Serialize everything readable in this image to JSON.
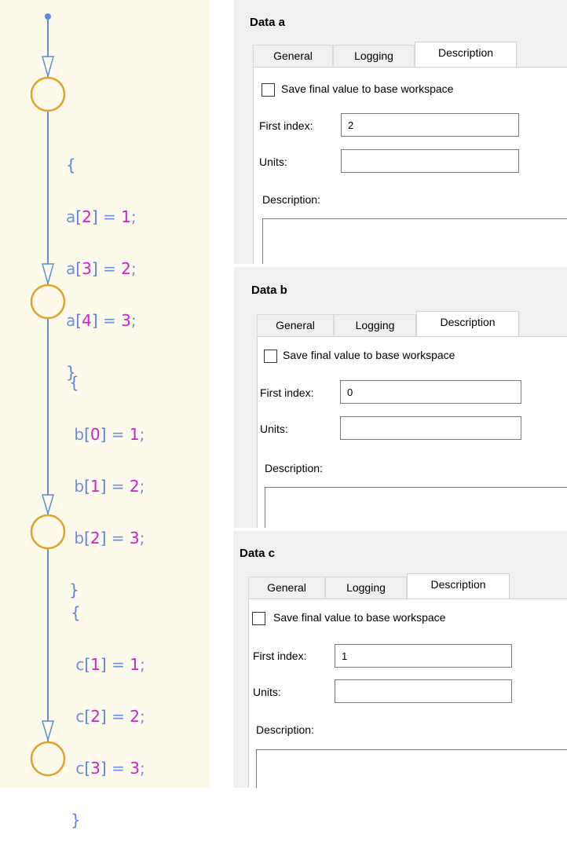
{
  "flow": {
    "blocks": [
      {
        "open": "{",
        "close": "}",
        "lines": [
          {
            "var": "a",
            "index": "2",
            "eq": "=",
            "value": "1",
            "semi": ";"
          },
          {
            "var": "a",
            "index": "3",
            "eq": "=",
            "value": "2",
            "semi": ";"
          },
          {
            "var": "a",
            "index": "4",
            "eq": "=",
            "value": "3",
            "semi": ";"
          }
        ]
      },
      {
        "open": "{",
        "close": "}",
        "lines": [
          {
            "var": "b",
            "index": "0",
            "eq": "=",
            "value": "1",
            "semi": ";"
          },
          {
            "var": "b",
            "index": "1",
            "eq": "=",
            "value": "2",
            "semi": ";"
          },
          {
            "var": "b",
            "index": "2",
            "eq": "=",
            "value": "3",
            "semi": ";"
          }
        ]
      },
      {
        "open": "{",
        "close": "}",
        "lines": [
          {
            "var": "c",
            "index": "1",
            "eq": "=",
            "value": "1",
            "semi": ";"
          },
          {
            "var": "c",
            "index": "2",
            "eq": "=",
            "value": "2",
            "semi": ";"
          },
          {
            "var": "c",
            "index": "3",
            "eq": "=",
            "value": "3",
            "semi": ";"
          }
        ]
      }
    ],
    "colors": {
      "background": "#fdfaeb",
      "line": "#5b8fd8",
      "junction": "#e0a22a",
      "text": "#6d8fe0",
      "number": "#cc22cc"
    }
  },
  "panels": [
    {
      "title": "Data a",
      "tabs": [
        "General",
        "Logging",
        "Description"
      ],
      "active_tab": "Description",
      "checkbox_label": "Save final value to base workspace",
      "checkbox_checked": false,
      "first_index_label": "First index:",
      "first_index_value": "2",
      "units_label": "Units:",
      "units_value": "",
      "description_label": "Description:",
      "description_value": ""
    },
    {
      "title": "Data b",
      "tabs": [
        "General",
        "Logging",
        "Description"
      ],
      "active_tab": "Description",
      "checkbox_label": "Save final value to base workspace",
      "checkbox_checked": false,
      "first_index_label": "First index:",
      "first_index_value": "0",
      "units_label": "Units:",
      "units_value": "",
      "description_label": "Description:",
      "description_value": ""
    },
    {
      "title": "Data c",
      "tabs": [
        "General",
        "Logging",
        "Description"
      ],
      "active_tab": "Description",
      "checkbox_label": "Save final value to base workspace",
      "checkbox_checked": false,
      "first_index_label": "First index:",
      "first_index_value": "1",
      "units_label": "Units:",
      "units_value": "",
      "description_label": "Description:",
      "description_value": ""
    }
  ]
}
